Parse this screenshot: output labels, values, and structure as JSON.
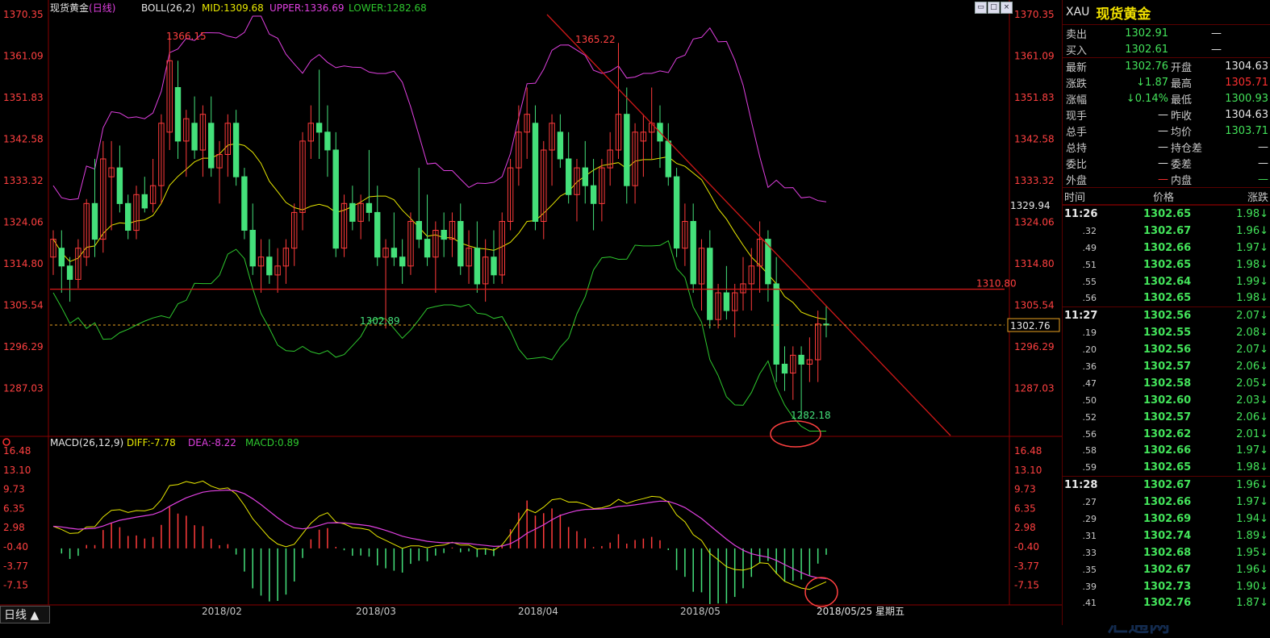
{
  "header": {
    "symbol_name": "现货黄金",
    "period": "(日线)",
    "boll_label": "BOLL(26,2)",
    "mid": "MID:1309.68",
    "upper": "UPPER:1336.69",
    "lower": "LOWER:1282.68"
  },
  "macd_header": {
    "label": "MACD(26,12,9)",
    "diff": "DIFF:-7.78",
    "dea": "DEA:-8.22",
    "macd": "MACD:0.89"
  },
  "colors": {
    "up": "#ff3b3b",
    "down": "#44e07a",
    "upper_band": "#e040e0",
    "mid_band": "#e8e800",
    "lower_band": "#2ec82e",
    "trendline": "#d01818",
    "axis_text": "#ff4040"
  },
  "price_axis_labels": [
    "1370.35",
    "1361.09",
    "1351.83",
    "1342.58",
    "1333.32",
    "1324.06",
    "1314.80",
    "1305.54",
    "1296.29",
    "1287.03"
  ],
  "macd_axis_labels": [
    "16.48",
    "13.10",
    "9.73",
    "6.35",
    "2.98",
    "-0.40",
    "-3.77",
    "-7.15"
  ],
  "x_labels": [
    "2018/02",
    "2018/03",
    "2018/04",
    "2018/05"
  ],
  "date_label": "2018/05/25 星期五",
  "annotations": {
    "high1": "1366.15",
    "high2": "1365.22",
    "low1": "1302.89",
    "low2": "1282.18",
    "resistance": "1310.80",
    "current_price": "1302.76",
    "box_value": "1329.94"
  },
  "period_button": "日线",
  "window_buttons": [
    "restore-icon",
    "maximize-icon",
    "close-icon"
  ],
  "watermark": "FX678汇通网",
  "chart_data": {
    "type": "candlestick",
    "title": "现货黄金(日线)",
    "xlabel": "",
    "ylabel": "",
    "ylim": [
      1278,
      1372
    ],
    "levels": {
      "resistance": 1310.8,
      "current": 1302.76
    },
    "series": [
      {
        "name": "现货黄金",
        "ohlc": [
          [
            1318,
            1324,
            1314,
            1322
          ],
          [
            1320,
            1324,
            1310,
            1316
          ],
          [
            1316,
            1318,
            1308,
            1313
          ],
          [
            1313,
            1322,
            1311,
            1320
          ],
          [
            1318,
            1331,
            1316,
            1330
          ],
          [
            1330,
            1340,
            1318,
            1322
          ],
          [
            1322,
            1344,
            1319,
            1340
          ],
          [
            1336,
            1344,
            1324,
            1338
          ],
          [
            1338,
            1343,
            1328,
            1330
          ],
          [
            1330,
            1332,
            1322,
            1324
          ],
          [
            1324,
            1334,
            1322,
            1332
          ],
          [
            1332,
            1336,
            1328,
            1329
          ],
          [
            1330,
            1340,
            1328,
            1334
          ],
          [
            1334,
            1350,
            1330,
            1348
          ],
          [
            1346,
            1368,
            1342,
            1362
          ],
          [
            1356,
            1362,
            1340,
            1344
          ],
          [
            1344,
            1351,
            1336,
            1349
          ],
          [
            1348,
            1354,
            1340,
            1342
          ],
          [
            1342,
            1352,
            1336,
            1350
          ],
          [
            1348,
            1354,
            1336,
            1338
          ],
          [
            1338,
            1344,
            1330,
            1341
          ],
          [
            1341,
            1350,
            1336,
            1348
          ],
          [
            1348,
            1351,
            1334,
            1336
          ],
          [
            1336,
            1338,
            1322,
            1324
          ],
          [
            1324,
            1330,
            1314,
            1316
          ],
          [
            1316,
            1322,
            1310,
            1318
          ],
          [
            1318,
            1322,
            1312,
            1314
          ],
          [
            1314,
            1320,
            1310,
            1316
          ],
          [
            1316,
            1322,
            1312,
            1320
          ],
          [
            1320,
            1330,
            1316,
            1328
          ],
          [
            1328,
            1346,
            1324,
            1344
          ],
          [
            1344,
            1352,
            1340,
            1348
          ],
          [
            1348,
            1360,
            1340,
            1346
          ],
          [
            1346,
            1352,
            1336,
            1342
          ],
          [
            1342,
            1346,
            1318,
            1320
          ],
          [
            1320,
            1332,
            1318,
            1330
          ],
          [
            1330,
            1334,
            1324,
            1326
          ],
          [
            1326,
            1332,
            1322,
            1330
          ],
          [
            1330,
            1342,
            1326,
            1328
          ],
          [
            1328,
            1334,
            1316,
            1318
          ],
          [
            1318,
            1322,
            1302,
            1320
          ],
          [
            1320,
            1328,
            1316,
            1318
          ],
          [
            1318,
            1322,
            1312,
            1316
          ],
          [
            1316,
            1328,
            1314,
            1326
          ],
          [
            1326,
            1338,
            1320,
            1322
          ],
          [
            1322,
            1332,
            1316,
            1318
          ],
          [
            1318,
            1326,
            1310,
            1324
          ],
          [
            1324,
            1328,
            1318,
            1322
          ],
          [
            1322,
            1328,
            1318,
            1326
          ],
          [
            1326,
            1330,
            1314,
            1316
          ],
          [
            1316,
            1324,
            1312,
            1320
          ],
          [
            1320,
            1326,
            1310,
            1312
          ],
          [
            1312,
            1322,
            1308,
            1318
          ],
          [
            1318,
            1324,
            1312,
            1314
          ],
          [
            1314,
            1328,
            1312,
            1326
          ],
          [
            1326,
            1340,
            1324,
            1338
          ],
          [
            1338,
            1352,
            1334,
            1346
          ],
          [
            1346,
            1356,
            1340,
            1350
          ],
          [
            1348,
            1352,
            1324,
            1326
          ],
          [
            1326,
            1344,
            1322,
            1342
          ],
          [
            1342,
            1350,
            1334,
            1348
          ],
          [
            1346,
            1350,
            1338,
            1340
          ],
          [
            1340,
            1346,
            1330,
            1332
          ],
          [
            1332,
            1340,
            1326,
            1338
          ],
          [
            1338,
            1344,
            1330,
            1334
          ],
          [
            1334,
            1340,
            1324,
            1330
          ],
          [
            1330,
            1340,
            1326,
            1338
          ],
          [
            1338,
            1346,
            1334,
            1342
          ],
          [
            1342,
            1366,
            1340,
            1350
          ],
          [
            1350,
            1356,
            1330,
            1334
          ],
          [
            1334,
            1348,
            1330,
            1346
          ],
          [
            1344,
            1350,
            1336,
            1346
          ],
          [
            1346,
            1356,
            1340,
            1348
          ],
          [
            1348,
            1352,
            1338,
            1344
          ],
          [
            1344,
            1348,
            1334,
            1336
          ],
          [
            1336,
            1338,
            1318,
            1320
          ],
          [
            1320,
            1330,
            1316,
            1326
          ],
          [
            1326,
            1330,
            1310,
            1312
          ],
          [
            1312,
            1322,
            1306,
            1320
          ],
          [
            1320,
            1324,
            1302,
            1304
          ],
          [
            1304,
            1312,
            1302,
            1310
          ],
          [
            1310,
            1316,
            1304,
            1306
          ],
          [
            1306,
            1312,
            1300,
            1310
          ],
          [
            1310,
            1318,
            1306,
            1312
          ],
          [
            1312,
            1320,
            1306,
            1316
          ],
          [
            1316,
            1326,
            1310,
            1322
          ],
          [
            1322,
            1324,
            1308,
            1312
          ],
          [
            1312,
            1318,
            1290,
            1294
          ],
          [
            1294,
            1298,
            1288,
            1292
          ],
          [
            1292,
            1298,
            1286,
            1296
          ],
          [
            1296,
            1298,
            1282,
            1294
          ],
          [
            1294,
            1300,
            1290,
            1295
          ],
          [
            1295,
            1306,
            1290,
            1303
          ],
          [
            1303,
            1307,
            1300,
            1302.76
          ]
        ]
      }
    ],
    "macd": {
      "diff_last": -7.78,
      "dea_last": -8.22,
      "macd_last": 0.89,
      "ylim": [
        -9.5,
        17.5
      ]
    }
  },
  "side": {
    "code": "XAU",
    "name": "现货黄金",
    "sell_label": "卖出",
    "sell_value": "1302.91",
    "sell_extra": "—",
    "buy_label": "买入",
    "buy_value": "1302.61",
    "buy_extra": "—",
    "quotes": [
      {
        "l1": "最新",
        "v1": "1302.76",
        "c1": "g",
        "l2": "开盘",
        "v2": "1304.63",
        "c2": "w"
      },
      {
        "l1": "涨跌",
        "v1": "↓1.87",
        "c1": "g",
        "l2": "最高",
        "v2": "1305.71",
        "c2": "r"
      },
      {
        "l1": "涨幅",
        "v1": "↓0.14%",
        "c1": "g",
        "l2": "最低",
        "v2": "1300.93",
        "c2": "g"
      },
      {
        "l1": "现手",
        "v1": "—",
        "c1": "w",
        "l2": "昨收",
        "v2": "1304.63",
        "c2": "w"
      },
      {
        "l1": "总手",
        "v1": "—",
        "c1": "w",
        "l2": "均价",
        "v2": "1303.71",
        "c2": "g"
      },
      {
        "l1": "总持",
        "v1": "—",
        "c1": "w",
        "l2": "持仓差",
        "v2": "—",
        "c2": "w"
      },
      {
        "l1": "委比",
        "v1": "—",
        "c1": "w",
        "l2": "委差",
        "v2": "—",
        "c2": "w"
      },
      {
        "l1": "外盘",
        "v1": "—",
        "c1": "r",
        "l2": "内盘",
        "v2": "—",
        "c2": "g"
      }
    ],
    "tick_header": {
      "time": "时间",
      "price": "价格",
      "change": "涨跌"
    },
    "ticks": [
      {
        "time": "11:26",
        "price": "1302.65",
        "chg": "1.98↓",
        "full": true
      },
      {
        "time": ".32",
        "price": "1302.67",
        "chg": "1.96↓"
      },
      {
        "time": ".49",
        "price": "1302.66",
        "chg": "1.97↓"
      },
      {
        "time": ".51",
        "price": "1302.65",
        "chg": "1.98↓"
      },
      {
        "time": ".55",
        "price": "1302.64",
        "chg": "1.99↓"
      },
      {
        "time": ".56",
        "price": "1302.65",
        "chg": "1.98↓"
      },
      {
        "time": "11:27",
        "price": "1302.56",
        "chg": "2.07↓",
        "full": true
      },
      {
        "time": ".19",
        "price": "1302.55",
        "chg": "2.08↓"
      },
      {
        "time": ".20",
        "price": "1302.56",
        "chg": "2.07↓"
      },
      {
        "time": ".36",
        "price": "1302.57",
        "chg": "2.06↓"
      },
      {
        "time": ".47",
        "price": "1302.58",
        "chg": "2.05↓"
      },
      {
        "time": ".50",
        "price": "1302.60",
        "chg": "2.03↓"
      },
      {
        "time": ".52",
        "price": "1302.57",
        "chg": "2.06↓"
      },
      {
        "time": ".56",
        "price": "1302.62",
        "chg": "2.01↓"
      },
      {
        "time": ".58",
        "price": "1302.66",
        "chg": "1.97↓"
      },
      {
        "time": ".59",
        "price": "1302.65",
        "chg": "1.98↓"
      },
      {
        "time": "11:28",
        "price": "1302.67",
        "chg": "1.96↓",
        "full": true
      },
      {
        "time": ".27",
        "price": "1302.66",
        "chg": "1.97↓"
      },
      {
        "time": ".29",
        "price": "1302.69",
        "chg": "1.94↓"
      },
      {
        "time": ".31",
        "price": "1302.74",
        "chg": "1.89↓"
      },
      {
        "time": ".33",
        "price": "1302.68",
        "chg": "1.95↓"
      },
      {
        "time": ".35",
        "price": "1302.67",
        "chg": "1.96↓"
      },
      {
        "time": ".39",
        "price": "1302.73",
        "chg": "1.90↓"
      },
      {
        "time": ".41",
        "price": "1302.76",
        "chg": "1.87↓"
      }
    ]
  }
}
